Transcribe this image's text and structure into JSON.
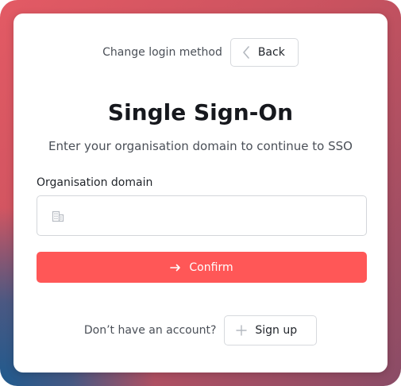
{
  "header": {
    "change_method_text": "Change login method",
    "back_label": "Back"
  },
  "main": {
    "title": "Single Sign-On",
    "subtitle": "Enter your organisation domain to continue to SSO",
    "domain_field": {
      "label": "Organisation domain",
      "value": "",
      "placeholder": ""
    },
    "confirm_label": "Confirm"
  },
  "footer": {
    "no_account_text": "Don’t have an account?",
    "signup_label": "Sign up"
  },
  "icons": {
    "back": "chevron-left-icon",
    "domain": "building-icon",
    "confirm": "arrow-right-icon",
    "signup": "plus-icon"
  },
  "colors": {
    "primary": "#ff5757",
    "background_start": "#e35a64",
    "background_end": "#8a4c66",
    "background_accent": "#1f5a8e"
  }
}
